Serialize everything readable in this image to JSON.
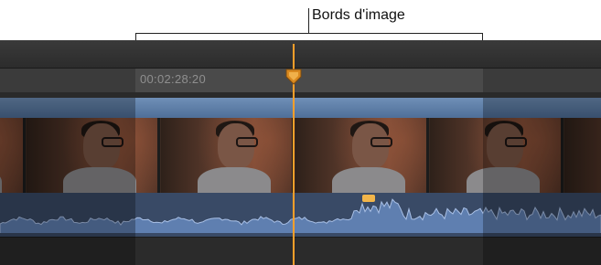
{
  "callout": {
    "label": "Bords d'image"
  },
  "timeline": {
    "timecode": "00:02:28:20",
    "clip_frame_count": 5
  },
  "colors": {
    "playhead": "#ff9f2a",
    "clip_band": "#5f80aa",
    "audio_wave": "#6e8fc0",
    "audio_bg": "#394a66"
  }
}
